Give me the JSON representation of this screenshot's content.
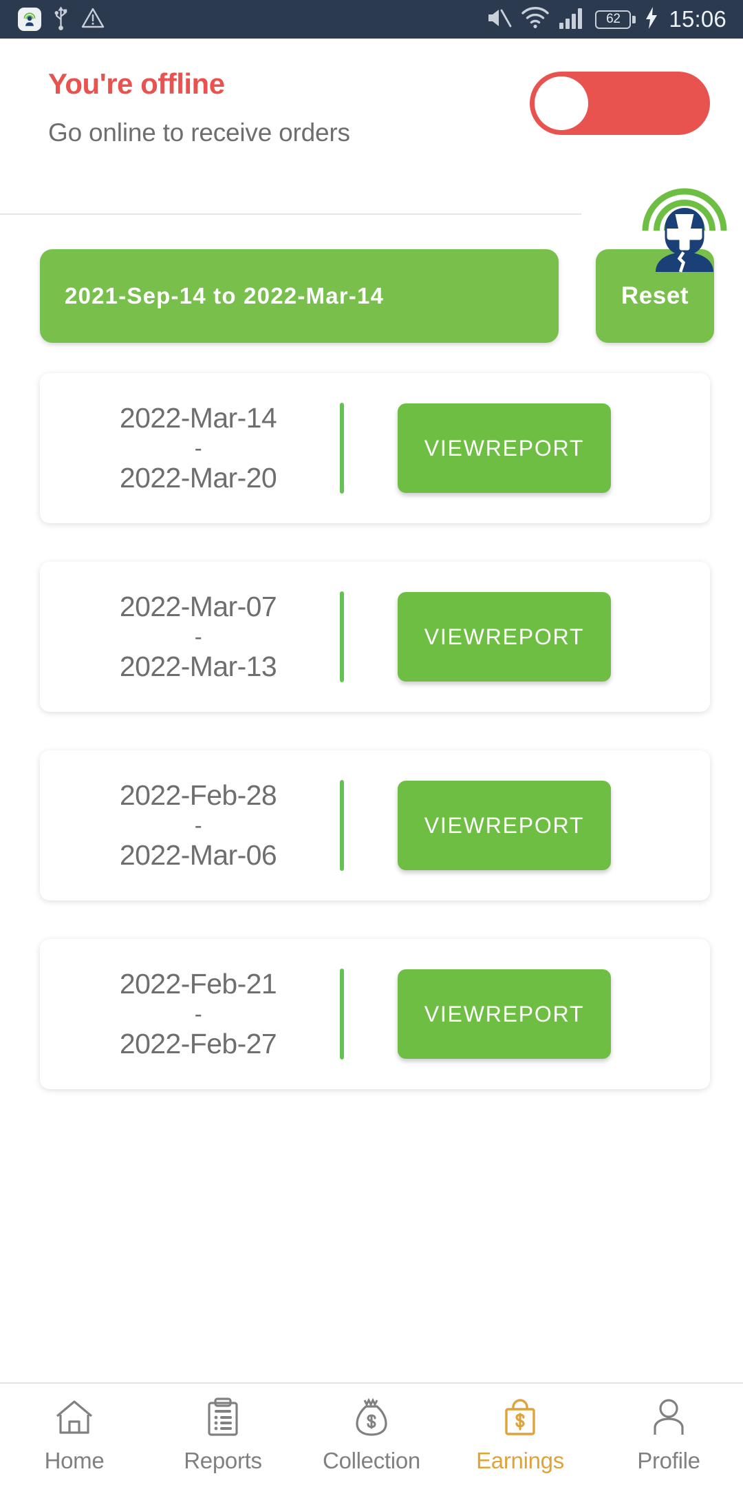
{
  "status_bar": {
    "background": "#2b3a4f",
    "left_icons": [
      "app-rider-badge-icon",
      "usb-icon",
      "warning-triangle-icon"
    ],
    "right_icons": [
      "mute-icon",
      "wifi-icon",
      "signal-bars-icon"
    ],
    "battery_level": "62",
    "charging": true,
    "time": "15:06"
  },
  "banner": {
    "title": "You're offline",
    "subtitle": "Go online to receive orders",
    "title_color": "#e9534f",
    "toggle": {
      "state": "off",
      "track_color": "#e9534f",
      "knob_color": "#ffffff"
    },
    "avatar_icon": "rider-helmet-signal-icon"
  },
  "filters": {
    "date_range_label": "2021-Sep-14 to 2022-Mar-14",
    "reset_label": "Reset",
    "accent_color": "#78bf4c"
  },
  "reports": {
    "button_label": "VIEWREPORT",
    "separator": "-",
    "cards": [
      {
        "start": "2022-Mar-14",
        "end": "2022-Mar-20"
      },
      {
        "start": "2022-Mar-07",
        "end": "2022-Mar-13"
      },
      {
        "start": "2022-Feb-28",
        "end": "2022-Mar-06"
      },
      {
        "start": "2022-Feb-21",
        "end": "2022-Feb-27"
      }
    ]
  },
  "bottom_nav": {
    "active_color": "#dfa33a",
    "inactive_color": "#808080",
    "items": [
      {
        "label": "Home",
        "icon": "home-icon"
      },
      {
        "label": "Reports",
        "icon": "clipboard-icon"
      },
      {
        "label": "Collection",
        "icon": "money-bag-icon"
      },
      {
        "label": "Earnings",
        "icon": "briefcase-dollar-icon"
      },
      {
        "label": "Profile",
        "icon": "person-icon"
      }
    ]
  }
}
